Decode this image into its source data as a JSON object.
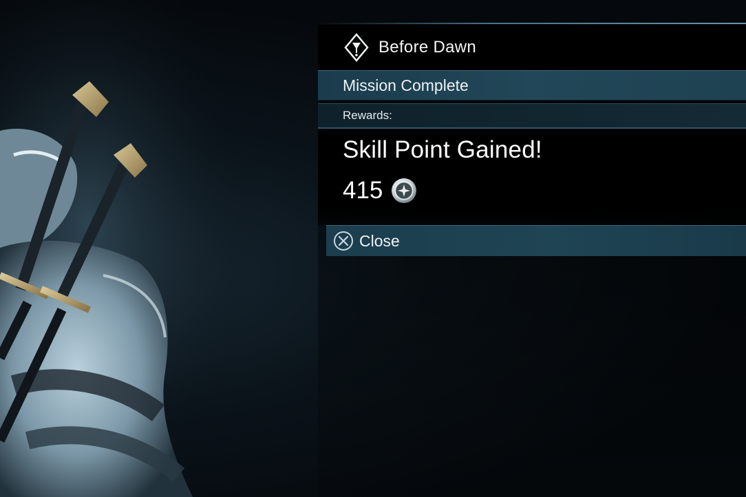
{
  "mission": {
    "name": "Before Dawn",
    "icon": "mission-diamond-icon"
  },
  "status": {
    "label": "Mission Complete"
  },
  "rewards": {
    "label": "Rewards:",
    "title": "Skill Point Gained!",
    "points": "415",
    "points_icon": "mirian-emblem-icon"
  },
  "actions": {
    "close_label": "Close",
    "close_icon": "cross-button-icon"
  },
  "colors": {
    "accent_bar": "#214758",
    "panel_bg": "#000000",
    "text": "#f2f4f5"
  }
}
